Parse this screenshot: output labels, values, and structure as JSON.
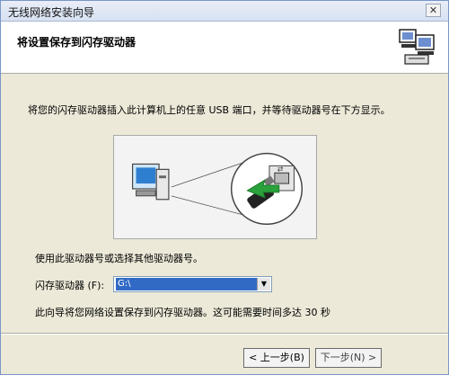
{
  "window": {
    "title": "无线网络安装向导",
    "close_glyph": "✕"
  },
  "header": {
    "title": "将设置保存到闪存驱动器"
  },
  "instruction": "将您的闪存驱动器插入此计算机上的任意 USB 端口，并等待驱动器号在下方显示。",
  "choose_text": "使用此驱动器号或选择其他驱动器号。",
  "drive": {
    "label": "闪存驱动器 (F):",
    "value": "G:\\",
    "arrow": "▼"
  },
  "note": "此向导将您网络设置保存到闪存驱动器。这可能需要时间多达 30 秒",
  "buttons": {
    "back": "< 上一步(B)",
    "next": "下一步(N) >"
  },
  "colors": {
    "accent": "#316ac5",
    "arrow": "#2aa13b"
  },
  "icons": [
    "computer-icon",
    "usb-drive-icon",
    "wizard-computers-icon",
    "arrow-icon"
  ]
}
